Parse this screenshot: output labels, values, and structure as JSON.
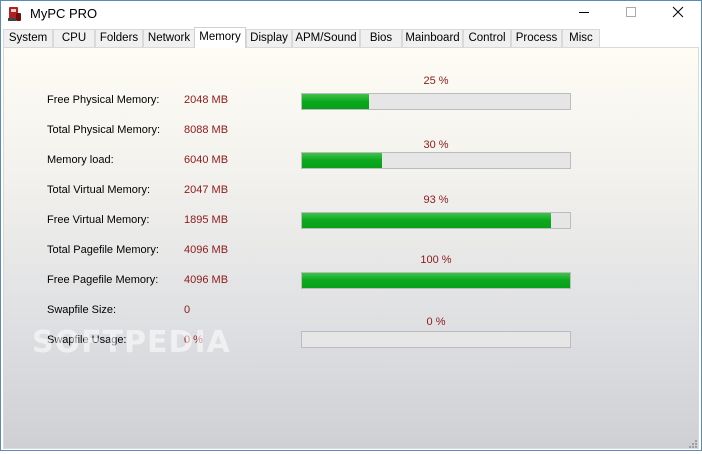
{
  "window": {
    "title": "MyPC PRO",
    "icon": "mypc-app-icon",
    "controls": [
      "minimize-icon",
      "maximize-icon",
      "close-icon"
    ]
  },
  "tabs": [
    {
      "label": "System",
      "active": false
    },
    {
      "label": "CPU",
      "active": false
    },
    {
      "label": "Folders",
      "active": false
    },
    {
      "label": "Network",
      "active": false
    },
    {
      "label": "Memory",
      "active": true
    },
    {
      "label": "Display",
      "active": false
    },
    {
      "label": "APM/Sound",
      "active": false
    },
    {
      "label": "Bios",
      "active": false
    },
    {
      "label": "Mainboard",
      "active": false
    },
    {
      "label": "Control",
      "active": false
    },
    {
      "label": "Process",
      "active": false
    },
    {
      "label": "Misc",
      "active": false
    }
  ],
  "memory": {
    "rows": [
      {
        "label": "Free Physical Memory:",
        "value": "2048 MB"
      },
      {
        "label": "Total Physical Memory:",
        "value": "8088 MB"
      },
      {
        "label": "Memory load:",
        "value": "6040 MB"
      },
      {
        "label": "Total Virtual Memory:",
        "value": "2047 MB"
      },
      {
        "label": "Free Virtual Memory:",
        "value": "1895 MB"
      },
      {
        "label": "Total Pagefile Memory:",
        "value": "4096 MB"
      },
      {
        "label": "Free Pagefile Memory:",
        "value": "4096 MB"
      },
      {
        "label": "Swapfile Size:",
        "value": "0"
      },
      {
        "label": "Swapfile Usage:",
        "value": "0 %"
      }
    ],
    "bars": [
      {
        "percent_label": "25 %",
        "fraction": 0.25
      },
      {
        "percent_label": "30 %",
        "fraction": 0.3
      },
      {
        "percent_label": "93 %",
        "fraction": 0.93
      },
      {
        "percent_label": "100 %",
        "fraction": 1.0
      },
      {
        "percent_label": "0 %",
        "fraction": 0.0
      }
    ]
  },
  "watermark": "SOFTPEDIA",
  "colors": {
    "value_text": "#8b1a1a",
    "bar_fill": "#0ba81e",
    "bar_track": "#e6e6e6"
  }
}
